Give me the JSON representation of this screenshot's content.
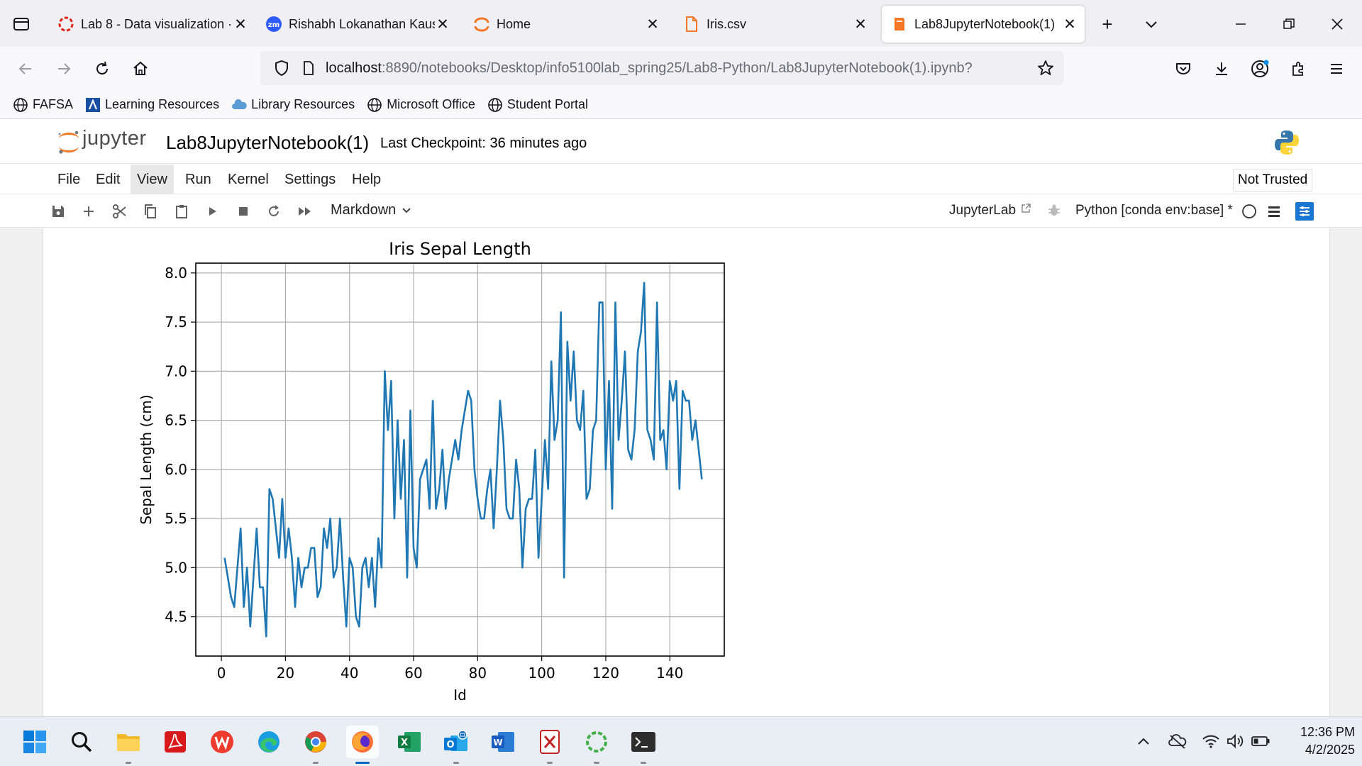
{
  "browser": {
    "tabs": [
      {
        "label": "Lab 8 - Data visualization ·",
        "icon": "loading-spinner-icon",
        "active": false
      },
      {
        "label": "Rishabh Lokanathan Kaush",
        "icon": "zoom-icon",
        "active": false
      },
      {
        "label": "Home",
        "icon": "jupyter-icon",
        "active": false
      },
      {
        "label": "Iris.csv",
        "icon": "file-icon",
        "active": false
      },
      {
        "label": "Lab8JupyterNotebook(1)",
        "icon": "notebook-icon",
        "active": true
      }
    ],
    "url_host": "localhost",
    "url_path": ":8890/notebooks/Desktop/info5100lab_spring25/Lab8-Python/Lab8JupyterNotebook(1).ipynb?",
    "bookmarks": [
      {
        "label": "FAFSA",
        "icon": "globe-icon"
      },
      {
        "label": "Learning Resources",
        "icon": "learning-resources-icon"
      },
      {
        "label": "Library Resources",
        "icon": "cloud-icon"
      },
      {
        "label": "Microsoft Office",
        "icon": "globe-icon"
      },
      {
        "label": "Student Portal",
        "icon": "globe-icon"
      }
    ]
  },
  "jupyter": {
    "logo_text": "jupyter",
    "notebook_name": "Lab8JupyterNotebook(1)",
    "checkpoint": "Last Checkpoint: 36 minutes ago",
    "menu": [
      "File",
      "Edit",
      "View",
      "Run",
      "Kernel",
      "Settings",
      "Help"
    ],
    "selected_menu": "View",
    "trust_status": "Not Trusted",
    "cell_type": "Markdown",
    "jupyterlab_link": "JupyterLab",
    "kernel_name": "Python [conda env:base] *"
  },
  "chart_data": {
    "type": "line",
    "title": "Iris Sepal Length",
    "xlabel": "Id",
    "ylabel": "Sepal Length (cm)",
    "xlim": [
      -8,
      157
    ],
    "ylim": [
      4.1,
      8.1
    ],
    "xticks": [
      0,
      20,
      40,
      60,
      80,
      100,
      120,
      140
    ],
    "yticks": [
      4.5,
      5.0,
      5.5,
      6.0,
      6.5,
      7.0,
      7.5,
      8.0
    ],
    "grid": true,
    "color": "#1f77b4",
    "x_start": 1,
    "x_step": 1,
    "y": [
      5.1,
      4.9,
      4.7,
      4.6,
      5.0,
      5.4,
      4.6,
      5.0,
      4.4,
      4.9,
      5.4,
      4.8,
      4.8,
      4.3,
      5.8,
      5.7,
      5.4,
      5.1,
      5.7,
      5.1,
      5.4,
      5.1,
      4.6,
      5.1,
      4.8,
      5.0,
      5.0,
      5.2,
      5.2,
      4.7,
      4.8,
      5.4,
      5.2,
      5.5,
      4.9,
      5.0,
      5.5,
      4.9,
      4.4,
      5.1,
      5.0,
      4.5,
      4.4,
      5.0,
      5.1,
      4.8,
      5.1,
      4.6,
      5.3,
      5.0,
      7.0,
      6.4,
      6.9,
      5.5,
      6.5,
      5.7,
      6.3,
      4.9,
      6.6,
      5.2,
      5.0,
      5.9,
      6.0,
      6.1,
      5.6,
      6.7,
      5.6,
      5.8,
      6.2,
      5.6,
      5.9,
      6.1,
      6.3,
      6.1,
      6.4,
      6.6,
      6.8,
      6.7,
      6.0,
      5.7,
      5.5,
      5.5,
      5.8,
      6.0,
      5.4,
      6.0,
      6.7,
      6.3,
      5.6,
      5.5,
      5.5,
      6.1,
      5.8,
      5.0,
      5.6,
      5.7,
      5.7,
      6.2,
      5.1,
      5.7,
      6.3,
      5.8,
      7.1,
      6.3,
      6.5,
      7.6,
      4.9,
      7.3,
      6.7,
      7.2,
      6.5,
      6.4,
      6.8,
      5.7,
      5.8,
      6.4,
      6.5,
      7.7,
      7.7,
      6.0,
      6.9,
      5.6,
      7.7,
      6.3,
      6.7,
      7.2,
      6.2,
      6.1,
      6.4,
      7.2,
      7.4,
      7.9,
      6.4,
      6.3,
      6.1,
      7.7,
      6.3,
      6.4,
      6.0,
      6.9,
      6.7,
      6.9,
      5.8,
      6.8,
      6.7,
      6.7,
      6.3,
      6.5,
      6.2,
      5.9
    ]
  },
  "taskbar": {
    "apps": [
      "windows-start-icon",
      "search-icon",
      "file-explorer-icon",
      "adobe-acrobat-icon",
      "wps-office-icon",
      "edge-icon",
      "chrome-icon",
      "firefox-icon",
      "excel-icon",
      "outlook-icon",
      "word-icon",
      "xampp-icon",
      "anaconda-icon",
      "terminal-icon"
    ],
    "time": "12:36 PM",
    "date": "4/2/2025"
  }
}
